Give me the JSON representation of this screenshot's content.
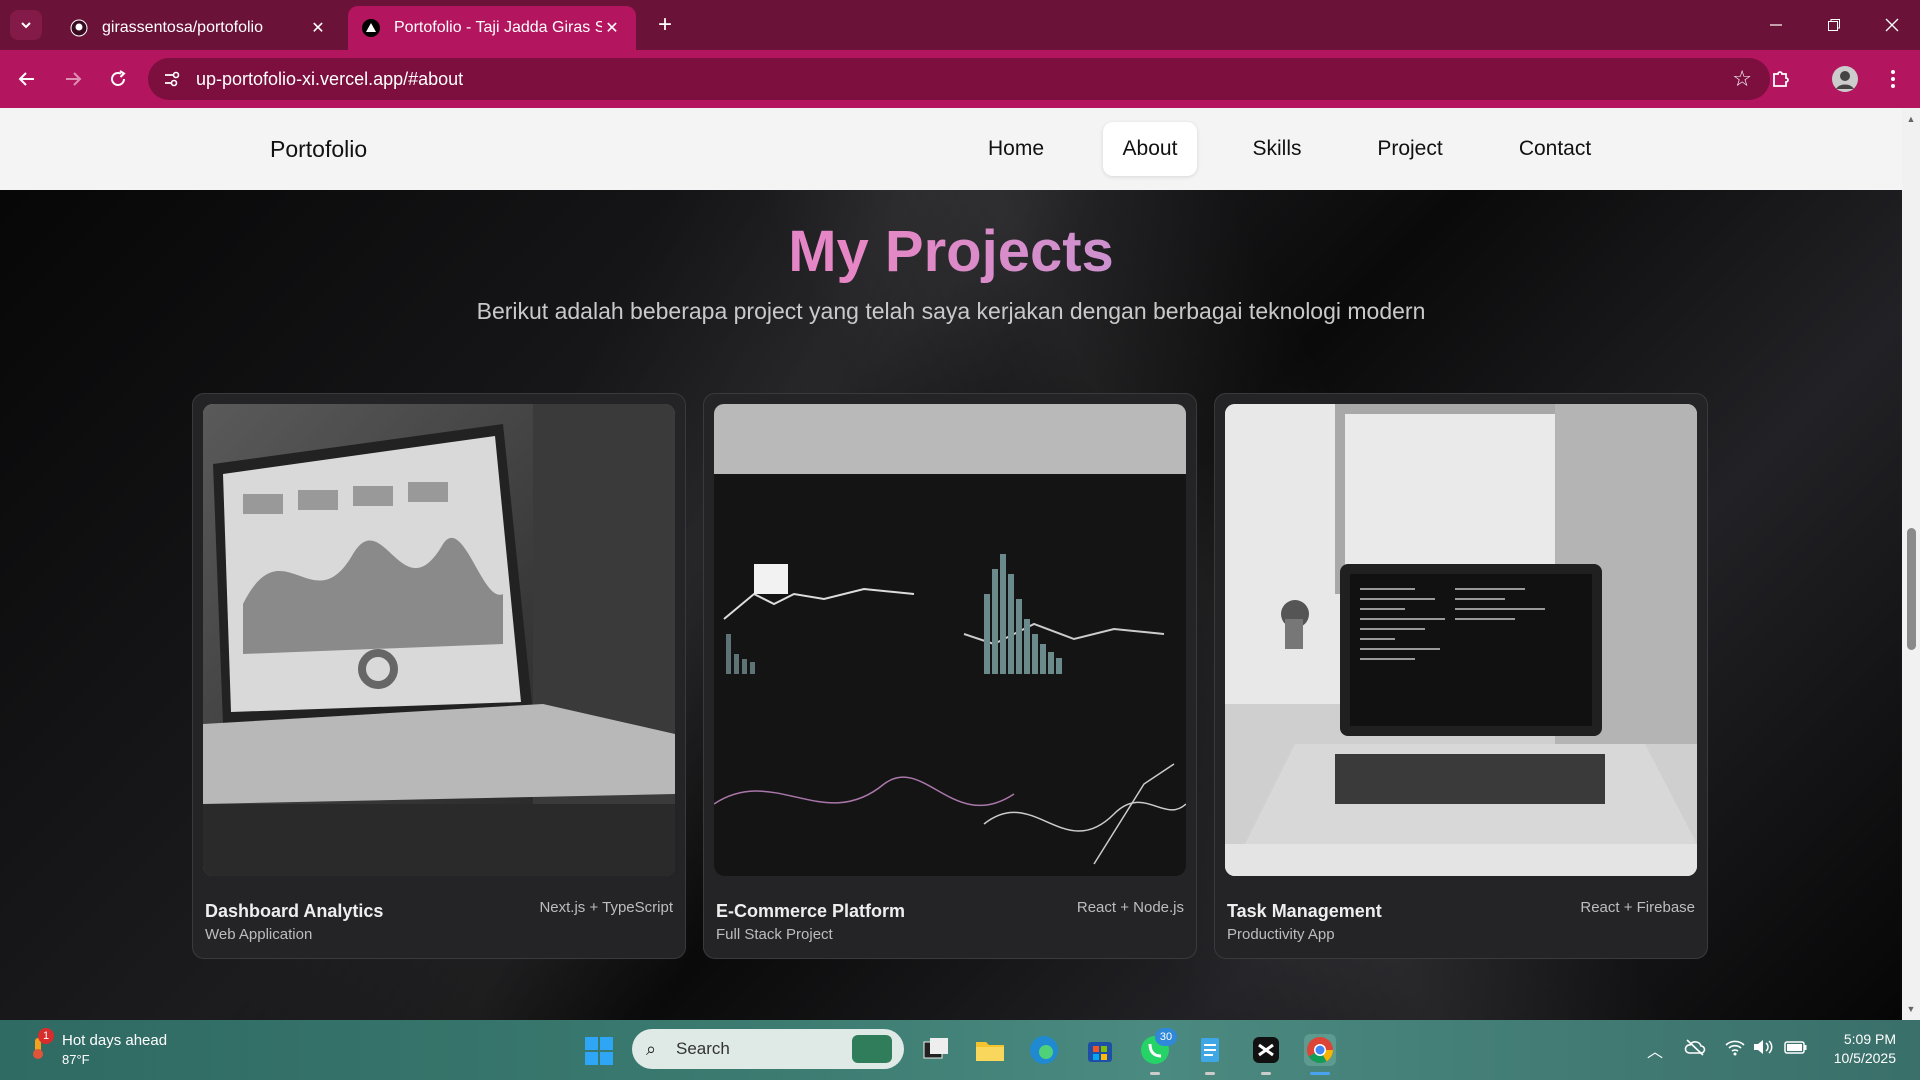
{
  "browser": {
    "tabs": [
      {
        "title": "girassentosa/portofolio",
        "active": false
      },
      {
        "title": "Portofolio - Taji Jadda Giras Sentosa",
        "active": true
      }
    ],
    "url": "up-portofolio-xi.vercel.app/#about"
  },
  "site": {
    "brand": "Portofolio",
    "nav": [
      {
        "label": "Home",
        "active": false
      },
      {
        "label": "About",
        "active": true
      },
      {
        "label": "Skills",
        "active": false
      },
      {
        "label": "Project",
        "active": false
      },
      {
        "label": "Contact",
        "active": false
      }
    ],
    "projects_title": "My Projects",
    "projects_subtitle": "Berikut adalah beberapa project yang telah saya kerjakan dengan berbagai teknologi modern",
    "projects": [
      {
        "name": "Dashboard Analytics",
        "category": "Web Application",
        "tech": "Next.js + TypeScript",
        "image": "laptop-dashboard-photo"
      },
      {
        "name": "E-Commerce Platform",
        "category": "Full Stack Project",
        "tech": "React + Node.js",
        "image": "analytics-screen-photo"
      },
      {
        "name": "Task Management",
        "category": "Productivity App",
        "tech": "React + Firebase",
        "image": "laptop-code-photo"
      }
    ]
  },
  "taskbar": {
    "weather_title": "Hot days ahead",
    "weather_temp": "87°F",
    "weather_badge": "1",
    "search_placeholder": "Search",
    "whatsapp_badge": "30",
    "time": "5:09 PM",
    "date": "10/5/2025"
  },
  "colors": {
    "tabbar": "#6b1238",
    "toolbar": "#b3155e",
    "title_gradient": [
      "#b37cf0",
      "#e786c4",
      "#7fb3f1"
    ]
  }
}
